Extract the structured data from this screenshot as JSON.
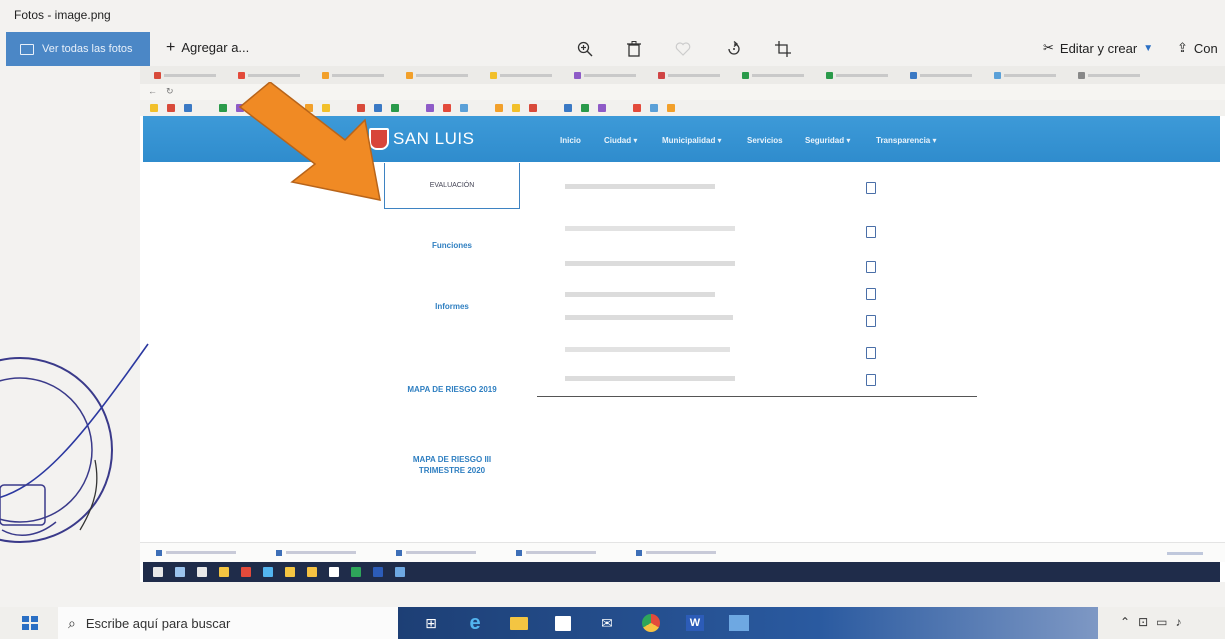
{
  "window": {
    "title": "Fotos - image.png"
  },
  "toolbar": {
    "see_all": "Ver todas las fotos",
    "add_to": "Agregar a...",
    "edit_create": "Editar y crear",
    "share": "Con"
  },
  "browser": {
    "tab_count": 12,
    "tab_colors": [
      "#d84a3a",
      "#e34a3a",
      "#f2a02a",
      "#f2a02a",
      "#f2c02a",
      "#8e5bc7",
      "#d04444",
      "#2a9a4a",
      "#2a9a4a",
      "#3a79c4",
      "#5aa0d8",
      "#888888"
    ]
  },
  "site": {
    "logo": "SAN LUIS",
    "nav": [
      "Inicio",
      "Ciudad ▾",
      "Municipalidad ▾",
      "Servicios",
      "Seguridad ▾",
      "Transparencia ▾"
    ]
  },
  "sidebar": {
    "evaluacion": "EVALUACIÓN",
    "funciones": "Funciones",
    "informes": "Informes",
    "mapa_2019": "MAPA DE RIESGO 2019",
    "mapa_2020_line1": "MAPA DE RIESGO III",
    "mapa_2020_line2": "TRIMESTRE 2020"
  },
  "taskbar": {
    "search_placeholder": "Escribe aquí para buscar"
  },
  "colors": {
    "nav_blue": "#2f8ccd",
    "arrow_orange": "#f08a24",
    "link_blue": "#2f7fc1",
    "stamp_ink": "#3a3a8a"
  }
}
